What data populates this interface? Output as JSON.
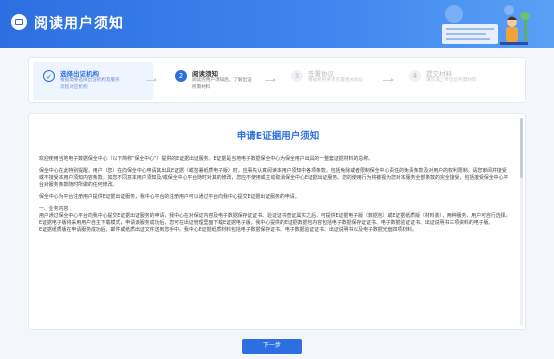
{
  "header": {
    "title": "阅读用户须知"
  },
  "steps": [
    {
      "num": "✓",
      "title": "选择出证机构",
      "desc": "根据需要选择出证机构及服务流程对应机构"
    },
    {
      "num": "2",
      "title": "阅读须知",
      "desc": "阅读完用户须知后，了解出证所需材料"
    },
    {
      "num": "3",
      "title": "签署协议",
      "desc": "根据机构要求签署相关协议"
    },
    {
      "num": "4",
      "title": "提交材料",
      "desc": "填写或上传出证所需材料"
    }
  ],
  "document": {
    "title": "申请E证据用户须知",
    "paragraphs": [
      "欢迎使用当地电子数据保全中心（以下简称“保全中心”）提供的E证据出证服务。E证据是当地电子数据保全中心为保全用户出具的一整套证据材料的总称。",
      "保全中心在此特别提醒，用户（您）在向保全中心申请其出具E证据（或签署纸质电子版）时，应事先认真阅读本用户须知中各项条款，包括免除或者限制保全中心责任的免责条款及对用户的权利限制。请您审阅并接受或不接受本用户须知内容条款。如您不同意本用户须知及/或保全中心平台随时对其的修改，您应不使用或主动取消保全中心E证据出证服务。您的使用行为将被视为您对本服务全部条款的完全接受，包括接受保全中心平台对服务条款随时所做的任何修改。",
      "保全中心为平台注册用户提供E证据出证服务，我中心平台的注册用户可以通过平台向我中心提交E证据出证服务的申请。",
      "一、业务内容",
      "用户通过保全中心平台向我中心提交E证据出证服务的申请，我中心在对保证内容及电子数据保存证证书、验证证书查证属实之后，可提供E证据电子版（数据包）或E证据纸质版（材料装），两种服务，用户可自行选择。",
      "E证据电子版将采用用户自主下载模式，申请该服务成功后，您可在出证管理里面下载E证据电子版。我中心提供的E证据数据包内容包括电子数据保存证证书、电子数据验证证书、出证说明书三项资料的电子版。",
      "E证据纸质版在申请服务成功后，邮件或纸质出证文件送到您手中。我中心E证据纸质材料包括电子数据保存证书、电子数据验证证书、出证说明书以及电子数据光盘四项材料。"
    ]
  },
  "buttons": {
    "next": "下一步"
  },
  "colors": {
    "primary": "#2d6fe0",
    "background": "#f3f6fb"
  }
}
